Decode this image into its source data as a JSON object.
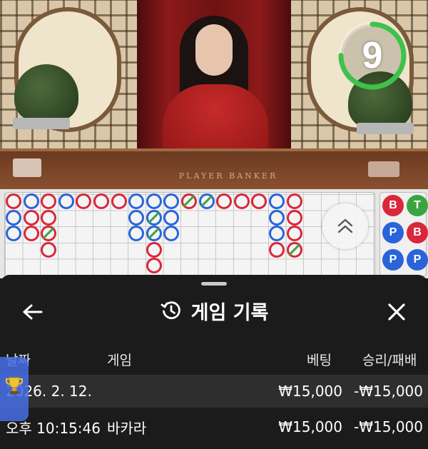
{
  "stream": {
    "countdown": "9",
    "countdown_progress": 0.75,
    "table_text": "PLAYER   BANKER"
  },
  "scoreboard": {
    "bead_columns": [
      [
        "red",
        "blue",
        "blue"
      ],
      [
        "blue",
        "red",
        "red"
      ],
      [
        "red",
        "red",
        "red-tie",
        "red"
      ],
      [
        "blue"
      ],
      [
        "red"
      ],
      [
        "red"
      ],
      [
        "red"
      ],
      [
        "blue",
        "blue",
        "blue"
      ],
      [
        "blue",
        "blue-tie",
        "blue-tie",
        "red",
        "red"
      ],
      [
        "blue",
        "blue",
        "blue"
      ],
      [
        "red-tie"
      ],
      [
        "blue-tie"
      ],
      [
        "red"
      ],
      [
        "red"
      ],
      [
        "red"
      ],
      [
        "blue",
        "blue",
        "blue",
        "red"
      ],
      [
        "red",
        "red",
        "red",
        "red-tie"
      ]
    ],
    "side_chips": [
      "B",
      "T",
      "P",
      "B",
      "P",
      "P"
    ]
  },
  "sheet": {
    "title": "게임 기록",
    "columns": {
      "date": "날짜",
      "game": "게임",
      "bet": "베팅",
      "result": "승리/패배"
    },
    "date_group": "2026. 2. 12.",
    "record": {
      "time": "오후 10:15:46",
      "game": "바카라",
      "bet": "₩15,000",
      "result": "-₩15,000"
    },
    "date_bet": "₩15,000",
    "date_result": "-₩15,000"
  },
  "icons": {
    "back": "arrow-left-icon",
    "history": "history-icon",
    "close": "close-icon",
    "collapse": "chevron-up-double-icon",
    "trophy": "trophy-icon"
  },
  "colors": {
    "banker": "#d8283a",
    "player": "#2a64d8",
    "tie": "#3aa540",
    "timer": "#3ec24a"
  }
}
